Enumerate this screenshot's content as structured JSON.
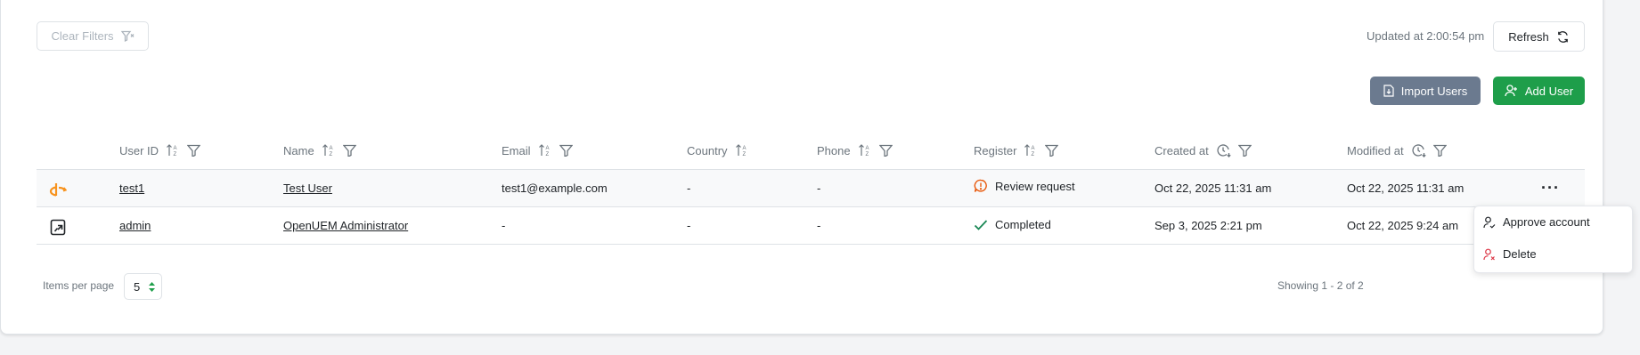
{
  "toolbar": {
    "clear_filters_label": "Clear Filters",
    "updated_text": "Updated at 2:00:54 pm",
    "refresh_label": "Refresh",
    "import_label": "Import Users",
    "add_label": "Add User"
  },
  "table": {
    "columns": [
      "User ID",
      "Name",
      "Email",
      "Country",
      "Phone",
      "Register",
      "Created at",
      "Modified at"
    ],
    "rows": [
      {
        "user_id": "test1",
        "name": "Test User",
        "email": "test1@example.com",
        "country": "-",
        "phone": "-",
        "register": "Review request",
        "created_at": "Oct 22, 2025 11:31 am",
        "modified_at": "Oct 22, 2025 11:31 am"
      },
      {
        "user_id": "admin",
        "name": "OpenUEM Administrator",
        "email": "-",
        "country": "-",
        "phone": "-",
        "register": "Completed",
        "created_at": "Sep 3, 2025 2:21 pm",
        "modified_at": "Oct 22, 2025 9:24 am"
      }
    ]
  },
  "row_menu": {
    "approve_label": "Approve account",
    "delete_label": "Delete"
  },
  "pagination": {
    "items_per_page_label": "Items per page",
    "items_per_page_value": "5",
    "showing_text": "Showing 1 - 2 of 2"
  },
  "colors": {
    "accent_green": "#1e9e4a",
    "import_gray": "#6b7a8f",
    "review_orange": "#e8590c",
    "complete_green": "#198754",
    "delete_red": "#dc3545"
  }
}
